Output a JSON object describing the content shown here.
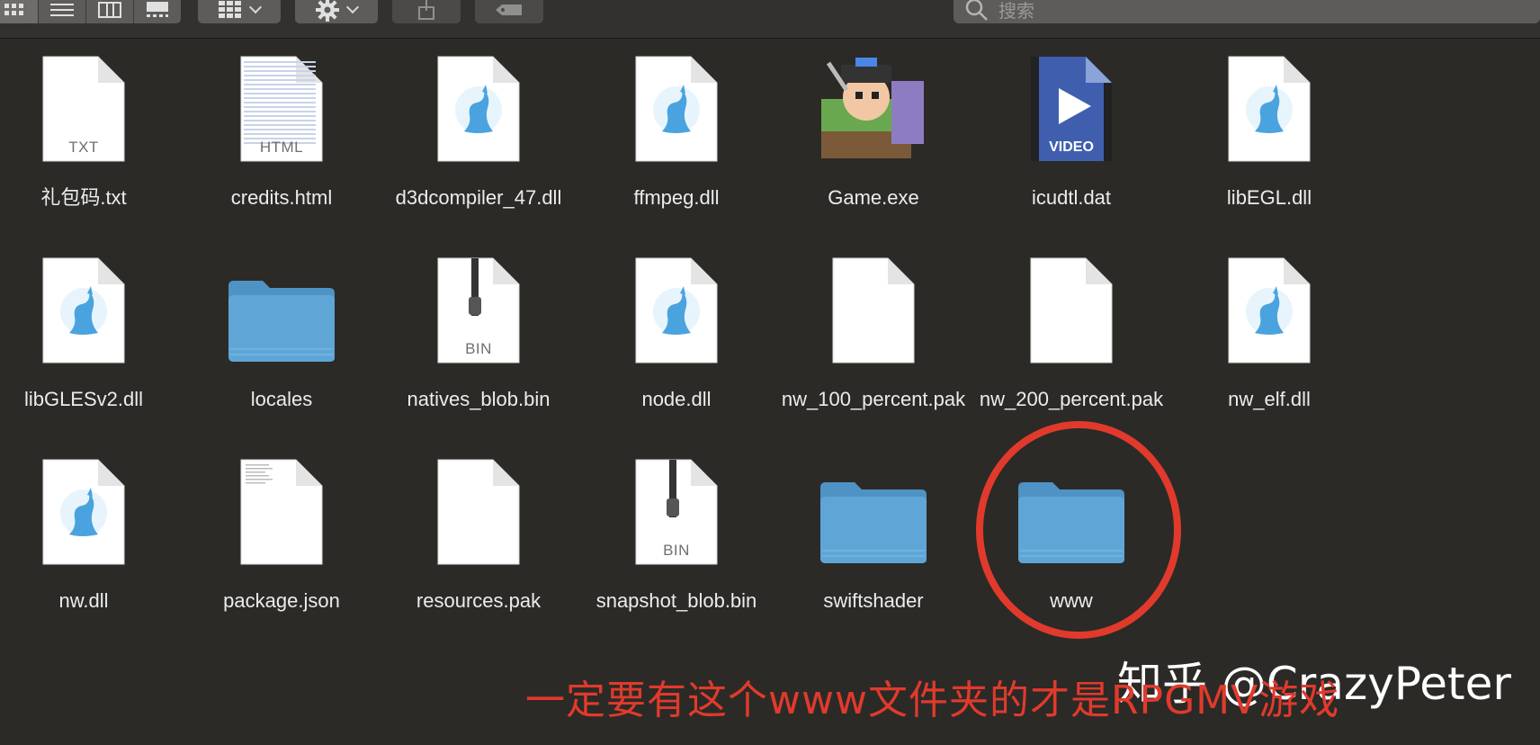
{
  "toolbar": {
    "search_placeholder": "搜索"
  },
  "files": [
    {
      "name": "礼包码.txt",
      "kind": "doc",
      "type_label": "TXT",
      "icon": "text-document-icon"
    },
    {
      "name": "credits.html",
      "kind": "doc",
      "type_label": "HTML",
      "icon": "html-document-icon"
    },
    {
      "name": "d3dcompiler_47.dll",
      "kind": "dll",
      "type_label": "",
      "icon": "dll-file-icon"
    },
    {
      "name": "ffmpeg.dll",
      "kind": "dll",
      "type_label": "",
      "icon": "dll-file-icon"
    },
    {
      "name": "Game.exe",
      "kind": "exe",
      "type_label": "",
      "icon": "game-app-icon"
    },
    {
      "name": "icudtl.dat",
      "kind": "video",
      "type_label": "VIDEO",
      "icon": "video-file-icon"
    },
    {
      "name": "libEGL.dll",
      "kind": "dll",
      "type_label": "",
      "icon": "dll-file-icon"
    },
    {
      "name": "libGLESv2.dll",
      "kind": "dll",
      "type_label": "",
      "icon": "dll-file-icon"
    },
    {
      "name": "locales",
      "kind": "folder",
      "type_label": "",
      "icon": "folder-icon"
    },
    {
      "name": "natives_blob.bin",
      "kind": "bin",
      "type_label": "BIN",
      "icon": "binary-file-icon"
    },
    {
      "name": "node.dll",
      "kind": "dll",
      "type_label": "",
      "icon": "dll-file-icon"
    },
    {
      "name": "nw_100_percent.pak",
      "kind": "blank",
      "type_label": "",
      "icon": "blank-document-icon"
    },
    {
      "name": "nw_200_percent.pak",
      "kind": "blank",
      "type_label": "",
      "icon": "blank-document-icon"
    },
    {
      "name": "nw_elf.dll",
      "kind": "dll",
      "type_label": "",
      "icon": "dll-file-icon"
    },
    {
      "name": "nw.dll",
      "kind": "dll",
      "type_label": "",
      "icon": "dll-file-icon"
    },
    {
      "name": "package.json",
      "kind": "doc",
      "type_label": "",
      "icon": "json-document-icon"
    },
    {
      "name": "resources.pak",
      "kind": "blank",
      "type_label": "",
      "icon": "blank-document-icon"
    },
    {
      "name": "snapshot_blob.bin",
      "kind": "bin",
      "type_label": "BIN",
      "icon": "binary-file-icon"
    },
    {
      "name": "swiftshader",
      "kind": "folder",
      "type_label": "",
      "icon": "folder-icon"
    },
    {
      "name": "www",
      "kind": "folder",
      "type_label": "",
      "icon": "folder-icon"
    }
  ],
  "annotation": {
    "caption": "一定要有这个www文件夹的才是RPGMV游戏",
    "watermark": "知乎 @CrazyPeter",
    "color": "#e13a2c"
  },
  "colors": {
    "background": "#2b2a27",
    "folder": "#5fa6d7",
    "dll_logo": "#4aa3df"
  }
}
